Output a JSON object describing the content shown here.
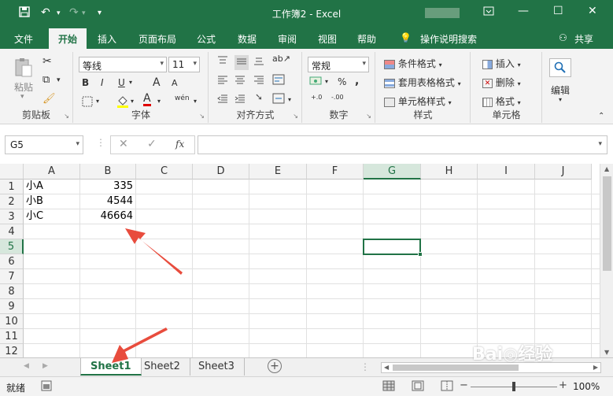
{
  "window": {
    "title": "工作簿2 - Excel"
  },
  "tabs": [
    "文件",
    "开始",
    "插入",
    "页面布局",
    "公式",
    "数据",
    "审阅",
    "视图",
    "帮助"
  ],
  "tell_me": "操作说明搜索",
  "share": "共享",
  "ribbon": {
    "clipboard": {
      "label": "剪贴板",
      "paste": "粘贴"
    },
    "font": {
      "label": "字体",
      "font_name": "等线",
      "font_size": "11",
      "bold": "B",
      "italic": "I",
      "underline": "U",
      "grow": "A",
      "shrink": "A",
      "font_color": "A",
      "wen": "wén"
    },
    "alignment": {
      "label": "对齐方式"
    },
    "number": {
      "label": "数字",
      "format": "常规",
      "percent": "%",
      "comma": ",",
      "inc": "+.0",
      "dec": "-.00"
    },
    "styles": {
      "label": "样式",
      "cond": "条件格式",
      "table": "套用表格格式",
      "cell": "单元格样式"
    },
    "cells": {
      "label": "单元格",
      "insert": "插入",
      "delete": "删除",
      "format": "格式"
    },
    "editing": {
      "label": "编辑"
    }
  },
  "formula_bar": {
    "name_box": "G5",
    "fx": "fx",
    "cancel": "✕",
    "enter": "✓"
  },
  "grid": {
    "columns": [
      "A",
      "B",
      "C",
      "D",
      "E",
      "F",
      "G",
      "H",
      "I",
      "J"
    ],
    "rows": [
      "1",
      "2",
      "3",
      "4",
      "5",
      "6",
      "7",
      "8",
      "9",
      "10",
      "11",
      "12"
    ],
    "selected_column": "G",
    "selected_row": "5",
    "cells": {
      "A1": "小A",
      "B1": "335",
      "A2": "小B",
      "B2": "4544",
      "A3": "小C",
      "B3": "46664"
    }
  },
  "sheets": [
    {
      "name": "Sheet1",
      "active": true
    },
    {
      "name": "Sheet2",
      "active": false
    },
    {
      "name": "Sheet3",
      "active": false
    }
  ],
  "status": {
    "ready": "就绪",
    "zoom": "100%",
    "minus": "−",
    "plus": "+"
  },
  "annotation_color": "#e84c3d",
  "accent": "#217346"
}
